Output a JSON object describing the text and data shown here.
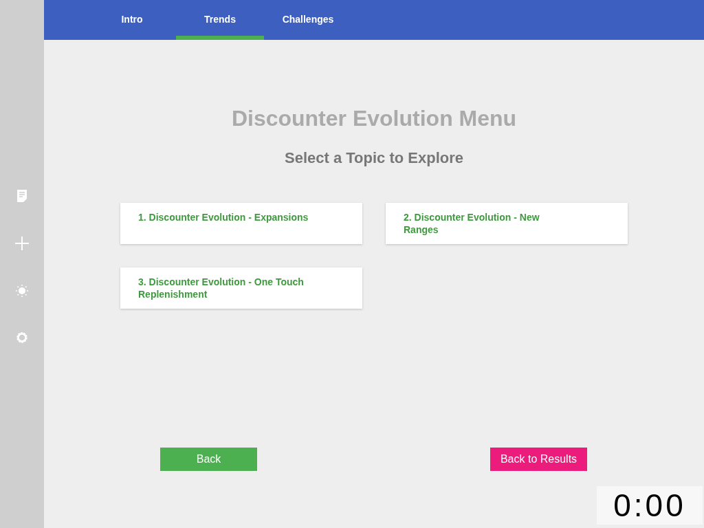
{
  "tabs": [
    {
      "label": "Intro",
      "selected": false
    },
    {
      "label": "Trends",
      "selected": true
    },
    {
      "label": "Challenges",
      "selected": false
    }
  ],
  "title": "Discounter Evolution Menu",
  "subtitle": "Select a Topic to Explore",
  "topics": [
    "1. Discounter Evolution - Expansions",
    "2. Discounter Evolution - New Ranges",
    "3. Discounter Evolution - One Touch Replenishment"
  ],
  "back_button": "Back",
  "results_button": "Back to Results",
  "timer": "0:00"
}
